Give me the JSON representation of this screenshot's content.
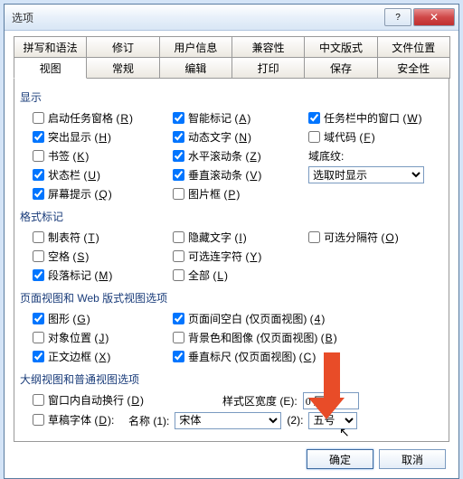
{
  "title": "选项",
  "tabs_row1": [
    "拼写和语法",
    "修订",
    "用户信息",
    "兼容性",
    "中文版式",
    "文件位置"
  ],
  "tabs_row2": [
    "视图",
    "常规",
    "编辑",
    "打印",
    "保存",
    "安全性"
  ],
  "active_tab": "视图",
  "sections": {
    "display": {
      "title": "显示"
    },
    "format": {
      "title": "格式标记"
    },
    "pageweb": {
      "title": "页面视图和 Web 版式视图选项"
    },
    "outline": {
      "title": "大纲视图和普通视图选项"
    }
  },
  "display_col1": [
    {
      "label": "启动任务窗格",
      "key": "R",
      "checked": false
    },
    {
      "label": "突出显示",
      "key": "H",
      "checked": true
    },
    {
      "label": "书签",
      "key": "K",
      "checked": false
    },
    {
      "label": "状态栏",
      "key": "U",
      "checked": true
    },
    {
      "label": "屏幕提示",
      "key": "Q",
      "checked": true
    }
  ],
  "display_col2": [
    {
      "label": "智能标记",
      "key": "A",
      "checked": true
    },
    {
      "label": "动态文字",
      "key": "N",
      "checked": true
    },
    {
      "label": "水平滚动条",
      "key": "Z",
      "checked": true
    },
    {
      "label": "垂直滚动条",
      "key": "V",
      "checked": true
    },
    {
      "label": "图片框",
      "key": "P",
      "checked": false
    }
  ],
  "display_col3": [
    {
      "label": "任务栏中的窗口",
      "key": "W",
      "checked": true
    },
    {
      "label": "域代码",
      "key": "F",
      "checked": false
    }
  ],
  "shading_label": "域底纹:",
  "shading_value": "选取时显示",
  "format_col1": [
    {
      "label": "制表符",
      "key": "T",
      "checked": false
    },
    {
      "label": "空格",
      "key": "S",
      "checked": false
    },
    {
      "label": "段落标记",
      "key": "M",
      "checked": true
    }
  ],
  "format_col2": [
    {
      "label": "隐藏文字",
      "key": "I",
      "checked": false
    },
    {
      "label": "可选连字符",
      "key": "Y",
      "checked": false
    },
    {
      "label": "全部",
      "key": "L",
      "checked": false
    }
  ],
  "format_col3": [
    {
      "label": "可选分隔符",
      "key": "O",
      "checked": false
    }
  ],
  "pageweb_col1": [
    {
      "label": "图形",
      "key": "G",
      "checked": true
    },
    {
      "label": "对象位置",
      "key": "J",
      "checked": false
    },
    {
      "label": "正文边框",
      "key": "X",
      "checked": true
    }
  ],
  "pageweb_col2": [
    {
      "label": "页面间空白 (仅页面视图)",
      "key": "4",
      "checked": true
    },
    {
      "label": "背景色和图像 (仅页面视图)",
      "key": "B",
      "checked": false
    },
    {
      "label": "垂直标尺 (仅页面视图)",
      "key": "C",
      "checked": true
    }
  ],
  "outline_items": [
    {
      "label": "窗口内自动换行",
      "key": "D",
      "checked": false
    },
    {
      "label": "草稿字体",
      "key": "D",
      "checked": false
    }
  ],
  "style_width_label": "样式区宽度",
  "style_width_key": "E",
  "style_width_value": "0 厘米",
  "name_label": "名称",
  "name_key": "1",
  "name_value": "宋体",
  "size_key": "2",
  "size_value": "五号",
  "ok": "确定",
  "cancel": "取消"
}
